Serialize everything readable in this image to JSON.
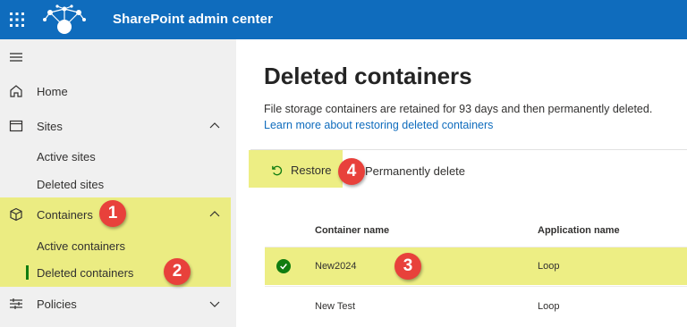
{
  "header": {
    "app_title": "SharePoint admin center",
    "waffle_icon": "app-launcher-icon",
    "logo_icon": "sharepoint-network-logo",
    "bg_color": "#0f6cbd"
  },
  "sidebar": {
    "collapse_icon": "hamburger-icon",
    "items": [
      {
        "label": "Home",
        "icon": "home-icon"
      },
      {
        "label": "Sites",
        "icon": "sites-icon",
        "expanded": true,
        "children": [
          "Active sites",
          "Deleted sites"
        ]
      },
      {
        "label": "Containers",
        "icon": "containers-icon",
        "expanded": true,
        "children": [
          "Active containers",
          "Deleted containers"
        ],
        "selected_child": "Deleted containers"
      },
      {
        "label": "Policies",
        "icon": "policies-icon",
        "expanded": false
      }
    ]
  },
  "main": {
    "title": "Deleted containers",
    "description": "File storage containers are retained for 93 days and then permanently deleted.",
    "learn_more": "Learn more about restoring deleted containers",
    "commands": {
      "restore": "Restore",
      "delete": "Permanently delete"
    },
    "table": {
      "columns": [
        "Container name",
        "Application name"
      ],
      "rows": [
        {
          "name": "New2024",
          "app": "Loop",
          "selected": true
        },
        {
          "name": "New Test",
          "app": "Loop",
          "selected": false
        }
      ]
    }
  },
  "annotations": {
    "badges": [
      "1",
      "2",
      "3",
      "4"
    ],
    "highlight_color": "#eaeb6f",
    "badge_color": "#e8413b"
  }
}
